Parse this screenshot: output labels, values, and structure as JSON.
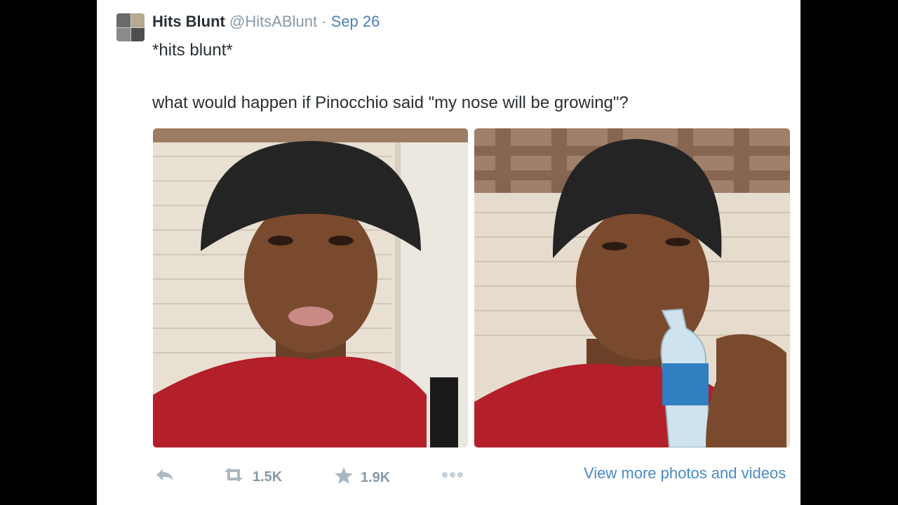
{
  "tweet": {
    "display_name": "Hits Blunt",
    "handle": "@HitsABlunt",
    "separator": "·",
    "date": "Sep 26",
    "line1": "*hits blunt*",
    "line2": "what would happen if Pinocchio said \"my nose will be growing\"?"
  },
  "photos": [
    {
      "description": "young man in black beanie and red shirt facing camera"
    },
    {
      "description": "young man in black beanie drinking from a water bottle"
    }
  ],
  "actions": {
    "retweet_count": "1.5K",
    "favorite_count": "1.9K",
    "more_label": "View more photos and videos"
  },
  "colors": {
    "link": "#4a8ac4",
    "muted": "#8899a6",
    "text": "#292f33"
  }
}
